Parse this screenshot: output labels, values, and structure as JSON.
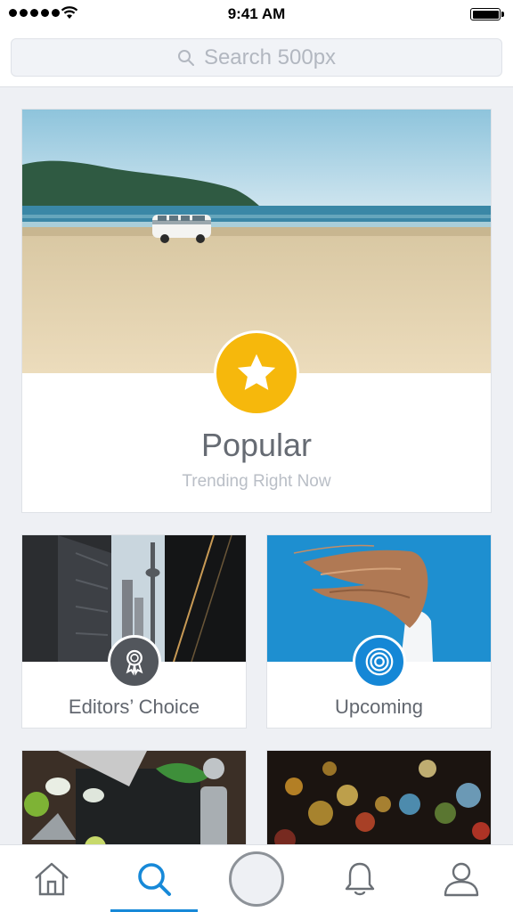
{
  "status_bar": {
    "time": "9:41 AM"
  },
  "search": {
    "placeholder": "Search 500px"
  },
  "featured": {
    "title": "Popular",
    "subtitle": "Trending Right Now",
    "badge_icon": "star-icon",
    "badge_color": "#f6b80c"
  },
  "categories": [
    {
      "title": "Editors’ Choice",
      "badge_icon": "award-ribbon-icon",
      "badge_color": "#52565c"
    },
    {
      "title": "Upcoming",
      "badge_icon": "concentric-circles-icon",
      "badge_color": "#1587d6"
    }
  ],
  "tab_bar": {
    "items": [
      {
        "icon": "home-icon",
        "active": false
      },
      {
        "icon": "search-icon",
        "active": true
      },
      {
        "icon": "camera-icon",
        "active": false
      },
      {
        "icon": "bell-icon",
        "active": false
      },
      {
        "icon": "profile-icon",
        "active": false
      }
    ],
    "accent": "#1789d8"
  }
}
